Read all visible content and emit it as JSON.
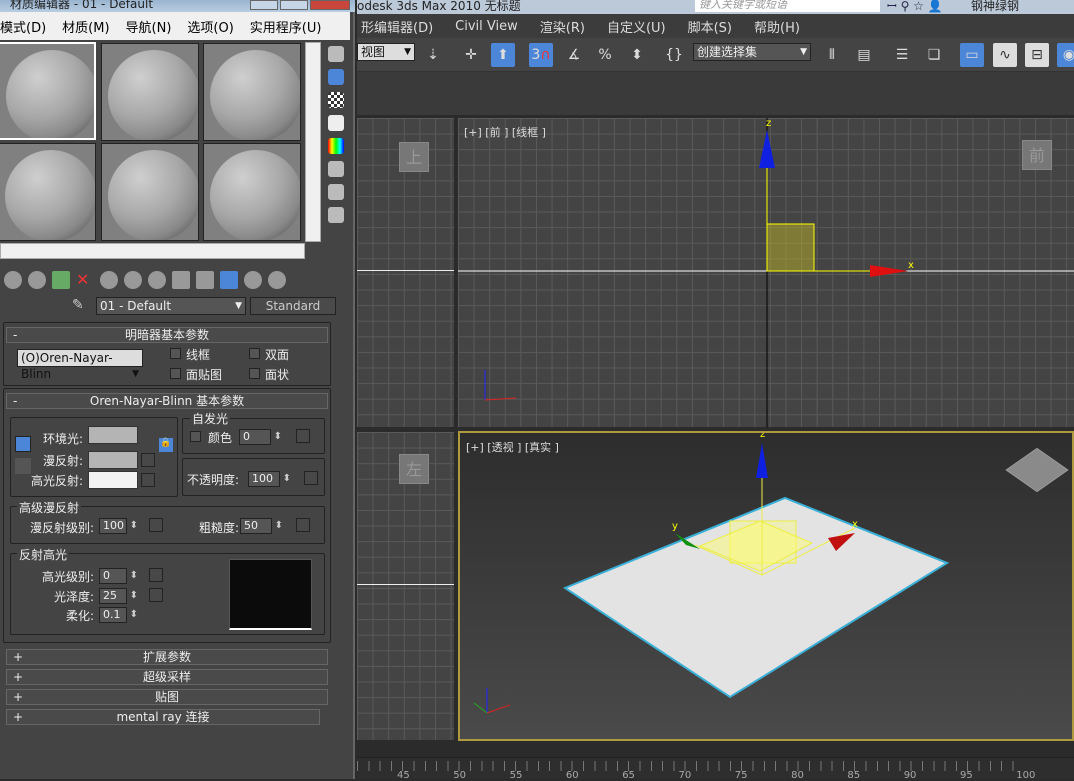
{
  "material_editor": {
    "title": "材质编辑器 - 01 - Default",
    "menu": [
      "模式(D)",
      "材质(M)",
      "导航(N)",
      "选项(O)",
      "实用程序(U)"
    ],
    "material_name": "01 - Default",
    "material_type": "Standard",
    "shader_rollout": {
      "title": "明暗器基本参数",
      "shader": "(O)Oren-Nayar-Blinn",
      "wire": "线框",
      "two_sided": "双面",
      "face_map": "面贴图",
      "faceted": "面状"
    },
    "basic_rollout": {
      "title": "Oren-Nayar-Blinn 基本参数",
      "ambient": "环境光:",
      "diffuse": "漫反射:",
      "specular": "高光反射:",
      "self_illum": {
        "title": "自发光",
        "color_label": "颜色",
        "value": "0"
      },
      "opacity": {
        "label": "不透明度:",
        "value": "100"
      },
      "advanced_diffuse": {
        "title": "高级漫反射",
        "level_label": "漫反射级别:",
        "level": "100",
        "roughness_label": "粗糙度:",
        "roughness": "50"
      },
      "specular_highlights": {
        "title": "反射高光",
        "level_label": "高光级别:",
        "level": "0",
        "gloss_label": "光泽度:",
        "gloss": "25",
        "soften_label": "柔化:",
        "soften": "0.1"
      }
    },
    "rollouts": [
      "扩展参数",
      "超级采样",
      "贴图",
      "mental ray 连接"
    ],
    "colors": {
      "ambient": "#b4b4b4",
      "diffuse": "#b4b4b4",
      "specular": "#f2f2f2"
    }
  },
  "app": {
    "title": "odesk 3ds Max 2010    无标题",
    "search_placeholder": "键入关键字或短语",
    "user": "钢神绿钢",
    "menu": [
      "形编辑器(D)",
      "Civil View",
      "渲染(R)",
      "自定义(U)",
      "脚本(S)",
      "帮助(H)"
    ],
    "toolbar": {
      "view_dropdown": "视图",
      "snap_label": "3",
      "selection_set": "创建选择集"
    }
  },
  "viewports": {
    "front": {
      "label": "[+] [前 ] [线框 ]",
      "cube": "前",
      "axis_x": "x",
      "axis_z": "z"
    },
    "top": {
      "cube": "上"
    },
    "left": {
      "cube": "左"
    },
    "perspective": {
      "label": "[+] [透视 ] [真实 ]",
      "axis_x": "x",
      "axis_y": "y",
      "axis_z": "z"
    }
  },
  "timeline": {
    "ticks": [
      "45",
      "50",
      "55",
      "60",
      "65",
      "70",
      "75",
      "80",
      "85",
      "90",
      "95",
      "100"
    ]
  }
}
